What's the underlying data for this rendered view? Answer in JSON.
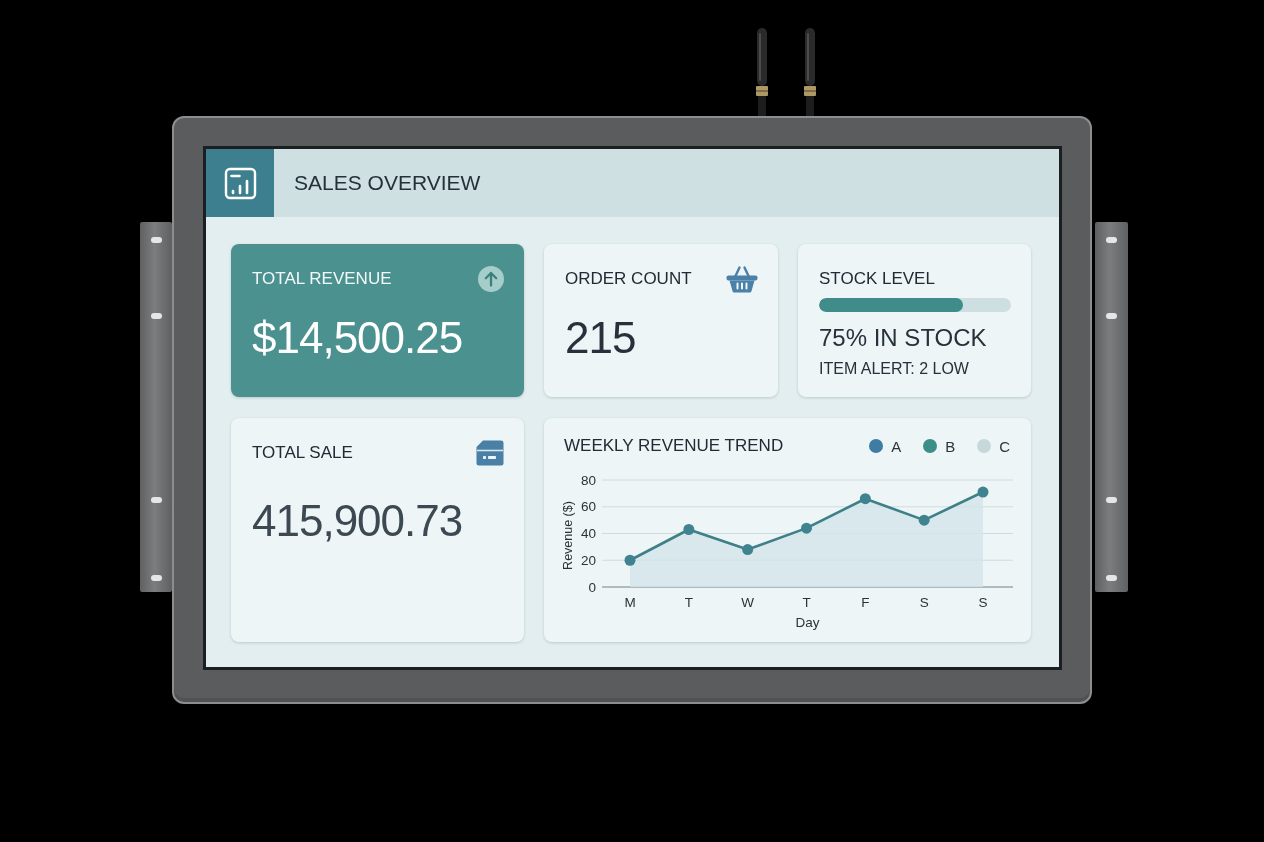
{
  "header": {
    "title": "SALES OVERVIEW"
  },
  "cards": [
    {
      "kind": "revenue",
      "label": "TOTAL REVENUE",
      "value": "$14,500.25",
      "highlighted": true
    },
    {
      "kind": "orders",
      "label": "ORDER COUNT",
      "value": "215",
      "highlighted": false
    },
    {
      "kind": "stock",
      "label": "STOCK LEVEL",
      "level": 0.75,
      "value": "75% IN STOCK",
      "note": "ITEM ALERT: 2 LOW",
      "highlighted": false
    },
    {
      "kind": "sales",
      "label": "TOTAL SALE",
      "value": "415,900.73",
      "highlighted": false
    }
  ],
  "chart": {
    "legend": [
      {
        "label": "A",
        "color": "#3e7ca3"
      },
      {
        "label": "B",
        "color": "#3d8d88"
      },
      {
        "label": "C",
        "color": "#c7d8db"
      }
    ],
    "chart_data": {
      "type": "area",
      "title": "WEEKLY REVENUE TREND",
      "xlabel": "Day",
      "ylabel": "Revenue ($)",
      "categories": [
        "M",
        "T",
        "W",
        "T",
        "F",
        "S",
        "S"
      ],
      "values": [
        20,
        43,
        28,
        44,
        66,
        50,
        71
      ],
      "ylim": [
        0,
        80
      ],
      "yticks": [
        0,
        20,
        40,
        60,
        80
      ],
      "grid": true
    }
  }
}
